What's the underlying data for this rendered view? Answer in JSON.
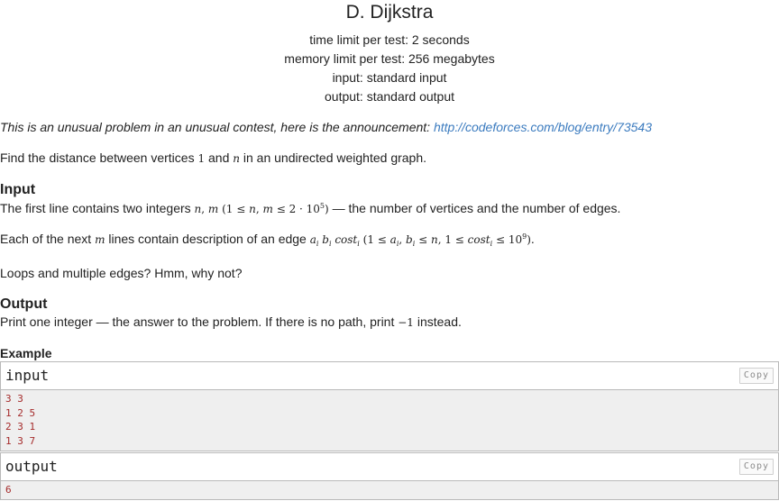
{
  "problem": {
    "title": "D. Dijkstra",
    "time_limit": "time limit per test: 2 seconds",
    "memory_limit": "memory limit per test: 256 megabytes",
    "input_file": "input: standard input",
    "output_file": "output: standard output"
  },
  "announcement": {
    "text": "This is an unusual problem in an unusual contest, here is the announcement: ",
    "link": "http://codeforces.com/blog/entry/73543"
  },
  "statement": {
    "p1_a": "Find the distance between vertices ",
    "p1_v1": "1",
    "p1_b": " and ",
    "p1_vn": "n",
    "p1_c": " in an undirected weighted graph."
  },
  "input_section": {
    "title": "Input",
    "l1_a": "The first line contains two integers ",
    "l1_b": " — the number of vertices and the number of edges.",
    "l2_a": "Each of the next ",
    "l2_m": "m",
    "l2_b": " lines contain description of an edge ",
    "l2_c": ".",
    "l3": "Loops and multiple edges? Hmm, why not?"
  },
  "output_section": {
    "title": "Output",
    "l1_a": "Print one integer — the answer to the problem. If there is no path, print ",
    "l1_val": "−1",
    "l1_b": " instead."
  },
  "example": {
    "title": "Example",
    "input_label": "input",
    "output_label": "output",
    "copy_label": "Copy",
    "input_lines": [
      "3 3",
      "1 2 5",
      "2 3 1",
      "1 3 7"
    ],
    "output_lines": [
      "6"
    ]
  }
}
